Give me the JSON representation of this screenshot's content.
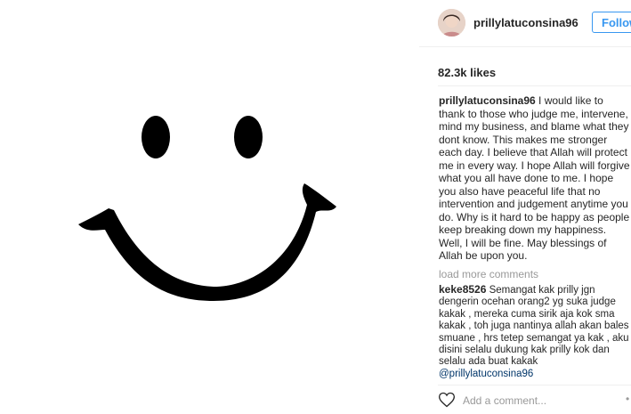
{
  "post": {
    "image_alt": "smiley face drawing"
  },
  "header": {
    "username": "prillylatuconsina96",
    "follow_label": "Follow"
  },
  "likes": "82.3k likes",
  "caption": {
    "author": "prillylatuconsina96",
    "text": "I would like to thank to those who judge me, intervene, mind my business, and blame what they dont know. This makes me stronger each day. I believe that Allah will protect me in every way. I hope Allah will forgive what you all have done to me. I hope you also have peaceful life that no intervention and judgement anytime you do. Why is it hard to be happy as people keep breaking down my happiness. Well, I will be fine. May blessings of Allah be upon you."
  },
  "load_more": "load more comments",
  "comments": [
    {
      "author": "keke8526",
      "text": "Semangat kak prilly jgn dengerin ocehan orang2 yg suka judge kakak , mereka cuma sirik aja kok sma kakak , toh juga nantinya allah akan bales smuane , hrs tetep semangat ya kak , aku disini selalu dukung kak prilly kok dan selalu ada buat kakak",
      "mention": "@prillylatuconsina96"
    }
  ],
  "footer": {
    "add_comment_placeholder": "Add a comment...",
    "more_glyph": "•"
  },
  "icons": {
    "like": "heart-icon",
    "options": "more-options-icon"
  }
}
